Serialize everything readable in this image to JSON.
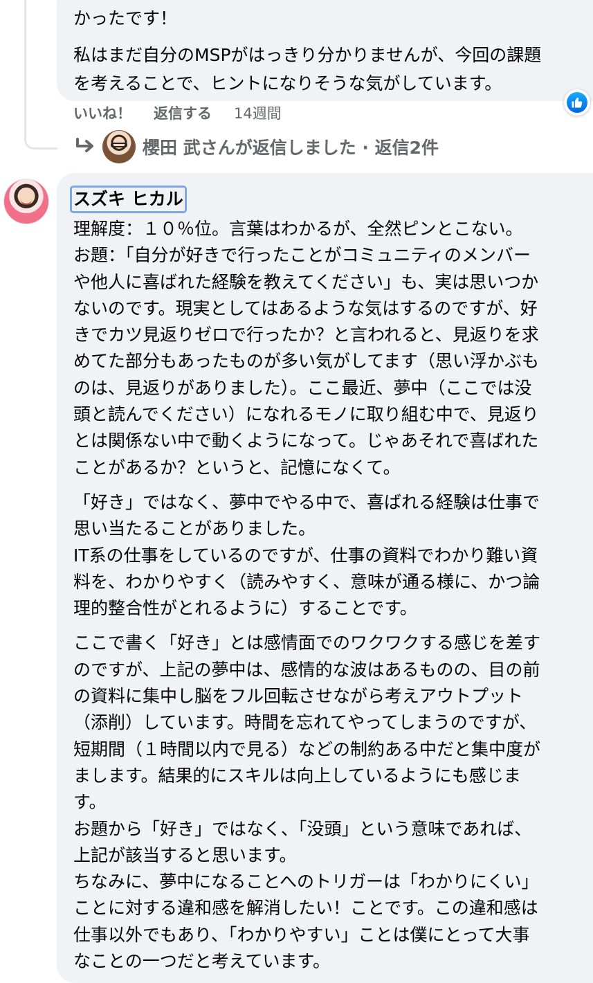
{
  "previous_comment": {
    "line1": "かったです！",
    "body": "私はまだ自分のMSPがはっきり分かりませんが、今回の課題\nを考えることで、ヒントになりそうな気がしています。",
    "like_label": "いいね！",
    "reply_label": "返信する",
    "time": "14週間",
    "reaction_icon": "thumbs-up-icon",
    "reply_summary": "櫻田 武さんが返信しました · 返信2件"
  },
  "comment": {
    "author": "スズキ ヒカル",
    "paragraphs": [
      "理解度：１０％位。言葉はわかるが、全然ピンとこない。\nお題：「自分が好きで行ったことがコミュニティのメンバー\nや他人に喜ばれた経験を教えてください」も、実は思いつか\nないのです。現実としてはあるような気はするのですが、好\nきでカツ見返りゼロで行ったか？と言われると、見返りを求\nめてた部分もあったものが多い気がしてます（思い浮かぶも\nのは、見返りがありました）。ここ最近、夢中（ここでは没\n頭と読んでください）になれるモノに取り組む中で、見返り\nとは関係ない中で動くようになって。じゃあそれで喜ばれた\nことがあるか？というと、記憶になくて。",
      "「好き」ではなく、夢中でやる中で、喜ばれる経験は仕事で\n思い当たることがありました。\nIT系の仕事をしているのですが、仕事の資料でわかり難い資\n料を、わかりやすく（読みやすく、意味が通る様に、かつ論\n理的整合性がとれるように）することです。",
      "ここで書く「好き」とは感情面でのワクワクする感じを差す\nのですが、上記の夢中は、感情的な波はあるものの、目の前\nの資料に集中し脳をフル回転させながら考えアウトプット\n（添削）しています。時間を忘れてやってしまうのですが、\n短期間（１時間以内で見る）などの制約ある中だと集中度が\nまします。結果的にスキルは向上しているようにも感じま\nす。\nお題から「好き」ではなく、「没頭」という意味であれば、\n上記が該当すると思います。\nちなみに、夢中になることへのトリガーは「わかりにくい」\nことに対する違和感を解消したい！ことです。この違和感は\n仕事以外でもあり、「わかりやすい」ことは僕にとって大事\nなことの一つだと考えています。"
    ]
  }
}
